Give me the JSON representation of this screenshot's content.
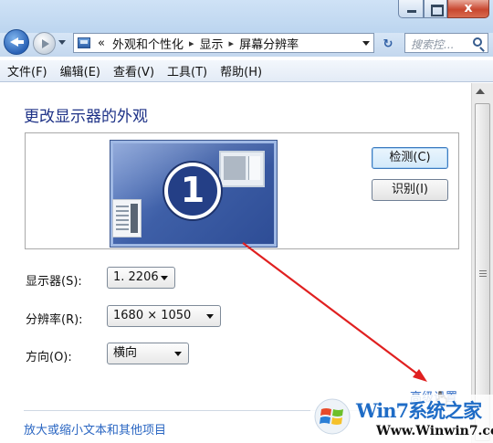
{
  "titlebar": {
    "close_glyph": "x"
  },
  "nav": {
    "breadcrumb_prefix": "«",
    "breadcrumbs": [
      "外观和个性化",
      "显示",
      "屏幕分辨率"
    ],
    "separator": "▸",
    "refresh_glyph": "↻",
    "search_placeholder": "搜索控..."
  },
  "menubar": {
    "items": [
      "文件(F)",
      "编辑(E)",
      "查看(V)",
      "工具(T)",
      "帮助(H)"
    ]
  },
  "page": {
    "title": "更改显示器的外观",
    "monitor_number": "1",
    "detect_button": "检测(C)",
    "identify_button": "识别(I)",
    "display_label": "显示器(S):",
    "display_value": "1. 2206",
    "resolution_label": "分辨率(R):",
    "resolution_value": "1680 × 1050",
    "orientation_label": "方向(O):",
    "orientation_value": "横向",
    "advanced_link": "高级设置",
    "bottom_link": "放大或缩小文本和其他项目"
  },
  "annotation": {
    "arrow_color": "#e02020"
  },
  "watermark": {
    "title": "Win7系统之家",
    "url": "Www.Winwin7.com"
  },
  "colors": {
    "title_blue": "#1e3287",
    "link_blue": "#2a66c2"
  }
}
